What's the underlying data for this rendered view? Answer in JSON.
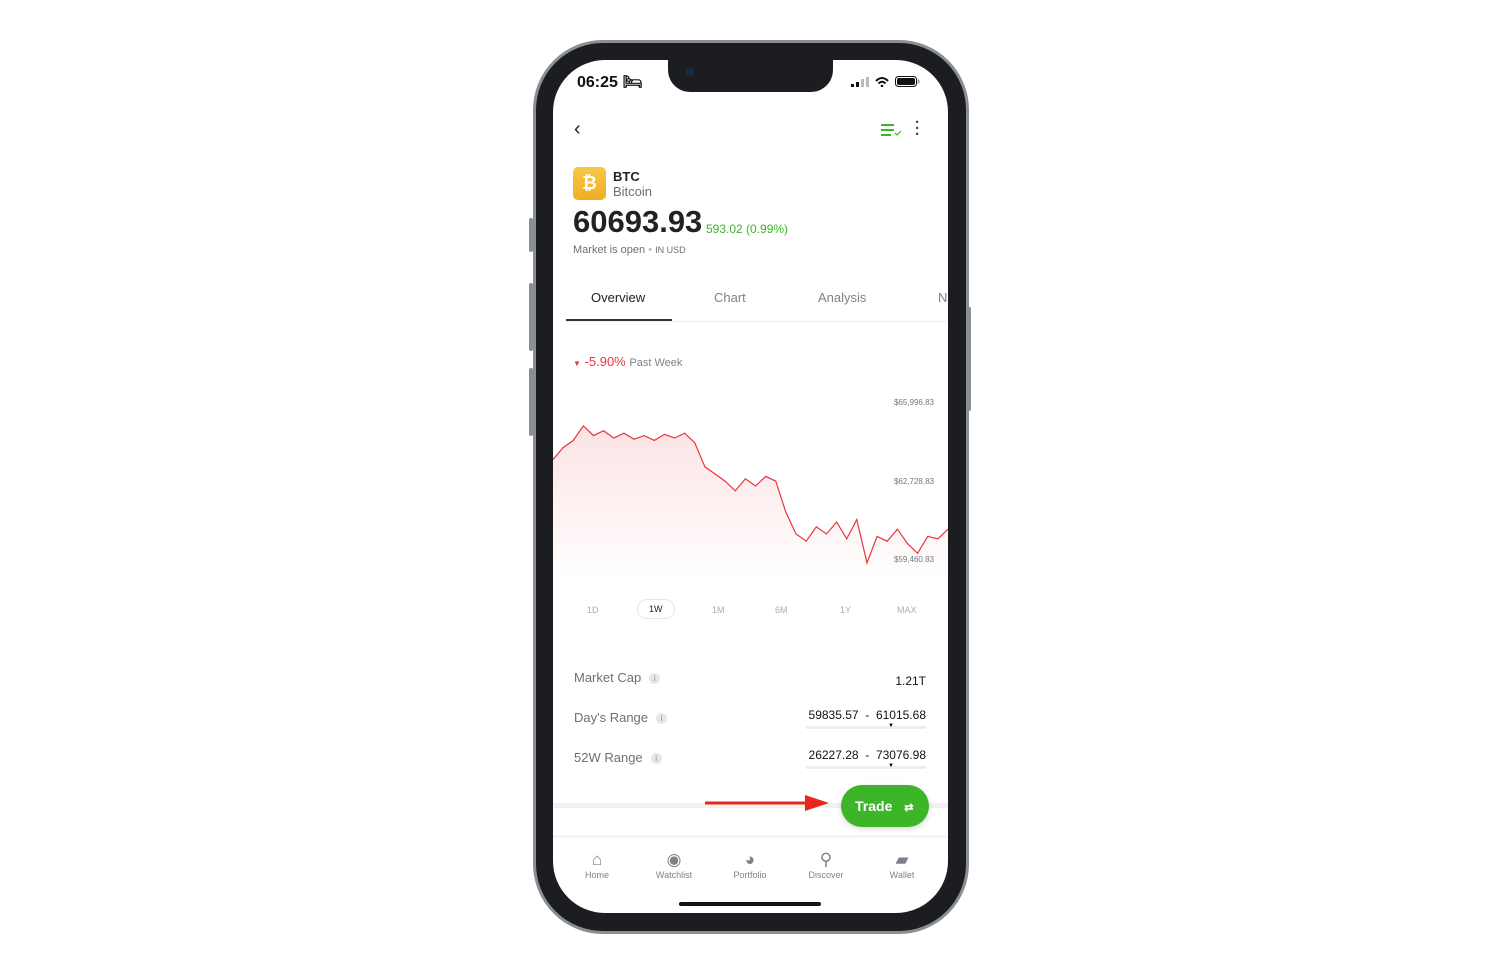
{
  "status_bar": {
    "time": "06:25"
  },
  "asset": {
    "symbol": "BTC",
    "name": "Bitcoin",
    "price": "60693.93",
    "change": "593.02 (0.99%)",
    "market_status": "Market is open",
    "currency": "IN USD",
    "icon": "bitcoin-icon",
    "brand_color": "#f5b82e"
  },
  "header": {
    "icons": [
      "back-icon",
      "watchlist-check-icon",
      "more-vertical-icon"
    ]
  },
  "tabs": [
    {
      "label": "Overview",
      "active": true
    },
    {
      "label": "Chart"
    },
    {
      "label": "Analysis"
    },
    {
      "label": "N"
    }
  ],
  "performance": {
    "change": "-5.90%",
    "period": "Past Week"
  },
  "chart_data": {
    "type": "area",
    "y_tick_labels": [
      "$65,996.83",
      "$62,728.83",
      "$59,460.83"
    ],
    "ylim": [
      58900,
      66500
    ],
    "color": "#e8363c",
    "x": [
      0,
      1,
      2,
      3,
      4,
      5,
      6,
      7,
      8,
      9,
      10,
      11,
      12,
      13,
      14,
      15,
      16,
      17,
      18,
      19,
      20,
      21,
      22,
      23,
      24,
      25,
      26,
      27,
      28,
      29,
      30,
      31,
      32,
      33,
      34,
      35,
      36,
      37,
      38,
      39
    ],
    "values": [
      63600,
      64100,
      64400,
      65000,
      64600,
      64800,
      64500,
      64700,
      64450,
      64600,
      64400,
      64650,
      64500,
      64700,
      64300,
      63300,
      63000,
      62700,
      62300,
      62800,
      62500,
      62900,
      62700,
      61400,
      60500,
      60200,
      60800,
      60500,
      61000,
      60300,
      61100,
      59300,
      60400,
      60200,
      60700,
      60100,
      59700,
      60400,
      60300,
      60700
    ],
    "ranges": [
      "1D",
      "1W",
      "1M",
      "6M",
      "1Y",
      "MAX"
    ],
    "selected_range": "1W"
  },
  "stats": [
    {
      "label": "Market Cap",
      "value": "1.21T"
    },
    {
      "label": "Day's Range",
      "low": "59835.57",
      "high": "61015.68",
      "sep": "-",
      "position": 0.73
    },
    {
      "label": "52W Range",
      "low": "26227.28",
      "high": "73076.98",
      "sep": "-",
      "position": 0.72
    }
  ],
  "trade_button": {
    "label": "Trade",
    "color": "#3cb528"
  },
  "bottom_nav": [
    {
      "label": "Home",
      "icon": "home-icon"
    },
    {
      "label": "Watchlist",
      "icon": "watchlist-eye-icon"
    },
    {
      "label": "Portfolio",
      "icon": "pie-chart-icon"
    },
    {
      "label": "Discover",
      "icon": "search-icon"
    },
    {
      "label": "Wallet",
      "icon": "wallet-icon"
    }
  ]
}
